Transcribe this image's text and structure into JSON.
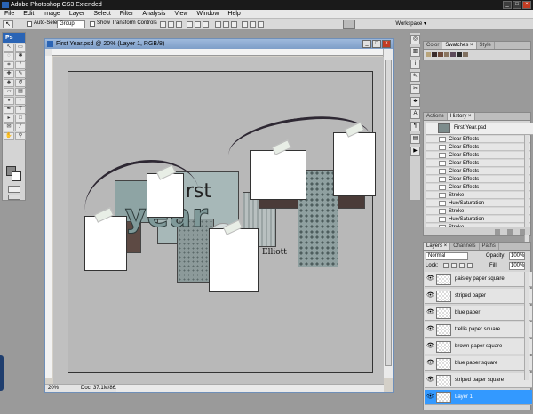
{
  "app": {
    "title": "Adobe Photoshop CS3 Extended"
  },
  "menu": [
    "File",
    "Edit",
    "Image",
    "Layer",
    "Select",
    "Filter",
    "Analysis",
    "View",
    "Window",
    "Help"
  ],
  "options": {
    "auto_select_label": "Auto-Select:",
    "auto_select_value": "Group",
    "transform_label": "Show Transform Controls",
    "workspace_label": "Workspace ▾"
  },
  "toolbox": {
    "logo": "Ps"
  },
  "document": {
    "title": "First Year.psd @ 20% (Layer 1, RGB/8)",
    "zoom": "20%",
    "doc_size": "Doc: 37.1M/86.5M",
    "art_text_first": "first",
    "art_text_year": "year",
    "art_text_name": "Elliott"
  },
  "swatch_panel": {
    "tabs": [
      "Color",
      "Swatches ×",
      "Style"
    ],
    "colors": [
      "#b8a47a",
      "#3a2c2c",
      "#6e4a3a",
      "#8a7560",
      "#5c4a5a",
      "#2b2b2b",
      "#807060"
    ]
  },
  "history_panel": {
    "tabs": [
      "Actions",
      "History ×"
    ],
    "snapshot": "First Year.psd",
    "items": [
      "Clear Effects",
      "Clear Effects",
      "Clear Effects",
      "Clear Effects",
      "Clear Effects",
      "Clear Effects",
      "Clear Effects",
      "Stroke",
      "Hue/Saturation",
      "Stroke",
      "Hue/Saturation",
      "Stroke"
    ]
  },
  "layers_panel": {
    "tabs": [
      "Layers ×",
      "Channels",
      "Paths"
    ],
    "blend_mode": "Normal",
    "opacity_label": "Opacity:",
    "opacity_value": "100%",
    "lock_label": "Lock:",
    "fill_label": "Fill:",
    "fill_value": "100%",
    "layers": [
      "paisley paper square",
      "striped paper",
      "blue paper",
      "trellis paper square",
      "brown paper square",
      "blue paper square",
      "striped paper square",
      "Layer 1"
    ]
  }
}
